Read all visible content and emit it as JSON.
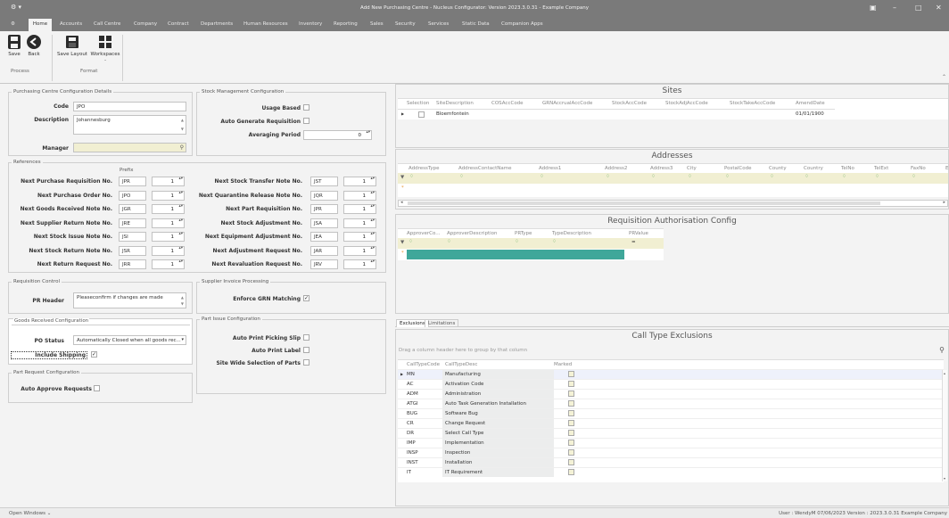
{
  "window": {
    "title": "Add New Purchasing Centre - Nucleus Configurator: Version 2023.3.0.31 - Example Company"
  },
  "menu": {
    "home": "Home",
    "items": [
      "Accounts",
      "Call Centre",
      "Company",
      "Contract",
      "Departments",
      "Human Resources",
      "Inventory",
      "Reporting",
      "Sales",
      "Security",
      "Services",
      "Static Data",
      "Companion Apps"
    ]
  },
  "ribbon": {
    "save": "Save",
    "back": "Back",
    "save_layout": "Save Layout",
    "workspaces": "Workspaces",
    "group_process": "Process",
    "group_format": "Format"
  },
  "pcd": {
    "legend": "Purchasing Centre Configuration Details",
    "code_label": "Code",
    "code": "JPO",
    "desc_label": "Description",
    "desc": "Johannesburg",
    "manager_label": "Manager",
    "manager": ""
  },
  "smc": {
    "legend": "Stock Management Configuration",
    "usage_based": "Usage Based",
    "auto_gen": "Auto Generate Requisition",
    "avg_label": "Averaging Period",
    "avg": "0"
  },
  "refs": {
    "legend": "References",
    "prefix_header": "Prefix",
    "left": [
      {
        "label": "Next Purchase Requisition No.",
        "prefix": "JPR",
        "num": "1"
      },
      {
        "label": "Next Purchase Order No.",
        "prefix": "JPO",
        "num": "1"
      },
      {
        "label": "Next Goods Received Note No.",
        "prefix": "JGR",
        "num": "1"
      },
      {
        "label": "Next Supplier Return Note No.",
        "prefix": "JRE",
        "num": "1"
      },
      {
        "label": "Next Stock Issue Note No.",
        "prefix": "JSI",
        "num": "1"
      },
      {
        "label": "Next Stock Return Note No.",
        "prefix": "JSR",
        "num": "1"
      },
      {
        "label": "Next Return Request No.",
        "prefix": "JRR",
        "num": "1"
      }
    ],
    "right": [
      {
        "label": "Next Stock Transfer Note No.",
        "prefix": "JST",
        "num": "1"
      },
      {
        "label": "Next Quarantine Release Note No.",
        "prefix": "JQR",
        "num": "1"
      },
      {
        "label": "Next Part Requisition No.",
        "prefix": "JPR",
        "num": "1"
      },
      {
        "label": "Next Stock Adjustment No.",
        "prefix": "JSA",
        "num": "1"
      },
      {
        "label": "Next Equipment Adjustment No.",
        "prefix": "JEA",
        "num": "1"
      },
      {
        "label": "Next Adjustment Request No.",
        "prefix": "JAR",
        "num": "1"
      },
      {
        "label": "Next Revaluation Request No.",
        "prefix": "JRV",
        "num": "1"
      }
    ]
  },
  "req": {
    "legend": "Requisition Control",
    "pr_header_label": "PR Header",
    "pr_header": "Pleaseconfirm if changes are made"
  },
  "sip": {
    "legend": "Supplier Invoice Processing",
    "enforce": "Enforce GRN Matching"
  },
  "grc": {
    "legend": "Goods Received Configuration",
    "po_status_label": "PO Status",
    "po_status": "Automatically Closed when all goods rec...",
    "include_shipping": "Include Shipping"
  },
  "pic": {
    "legend": "Part Issue Configuration",
    "auto_print_slip": "Auto Print Picking Slip",
    "auto_print_label": "Auto Print Label",
    "site_wide": "Site Wide Selection of Parts"
  },
  "prc": {
    "legend": "Part Request Configuration",
    "auto_approve": "Auto Approve Requests"
  },
  "sites": {
    "title": "Sites",
    "headers": [
      "Selection",
      "SiteDescription",
      "COSAccCode",
      "GRNAccrualAccCode",
      "StockAccCode",
      "StockAdjAccCode",
      "StockTakeAccCode",
      "AmendDate"
    ],
    "row": {
      "desc": "Bloemfontein",
      "date": "01/01/1900"
    }
  },
  "addresses": {
    "title": "Addresses",
    "headers": [
      "AddressType",
      "AddressContactName",
      "Address1",
      "Address2",
      "Address3",
      "City",
      "PostalCode",
      "County",
      "Country",
      "TelNo",
      "TelExt",
      "FaxNo",
      "E"
    ]
  },
  "rac": {
    "title": "Requisition Authorisation Config",
    "headers": [
      "ApproverCo...",
      "ApproverDescription",
      "PRType",
      "TypeDescription",
      "PRValue"
    ],
    "filter_eq": "="
  },
  "tabs": {
    "exclusions": "Exclusions",
    "limitations": "Limitations"
  },
  "cte": {
    "title": "Call Type Exclusions",
    "group_hint": "Drag a column header here to group by that column",
    "headers": [
      "CallTypeCode",
      "CallTypeDesc",
      "Marked"
    ],
    "rows": [
      {
        "code": "MN",
        "desc": "Manufacturing"
      },
      {
        "code": "AC",
        "desc": "Activation Code"
      },
      {
        "code": "ADM",
        "desc": "Administration"
      },
      {
        "code": "ATGI",
        "desc": "Auto Task Generation Installation"
      },
      {
        "code": "BUG",
        "desc": "Software Bug"
      },
      {
        "code": "CR",
        "desc": "Change Request"
      },
      {
        "code": "DR",
        "desc": "Select Call Type"
      },
      {
        "code": "IMP",
        "desc": "Implementation"
      },
      {
        "code": "INSP",
        "desc": "Inspection"
      },
      {
        "code": "INST",
        "desc": "Installation"
      },
      {
        "code": "IT",
        "desc": "IT Requirement"
      }
    ]
  },
  "status": {
    "open_windows": "Open Windows",
    "info": "User : WendyM  07/06/2023  Version : 2023.3.0.31  Example Company"
  }
}
